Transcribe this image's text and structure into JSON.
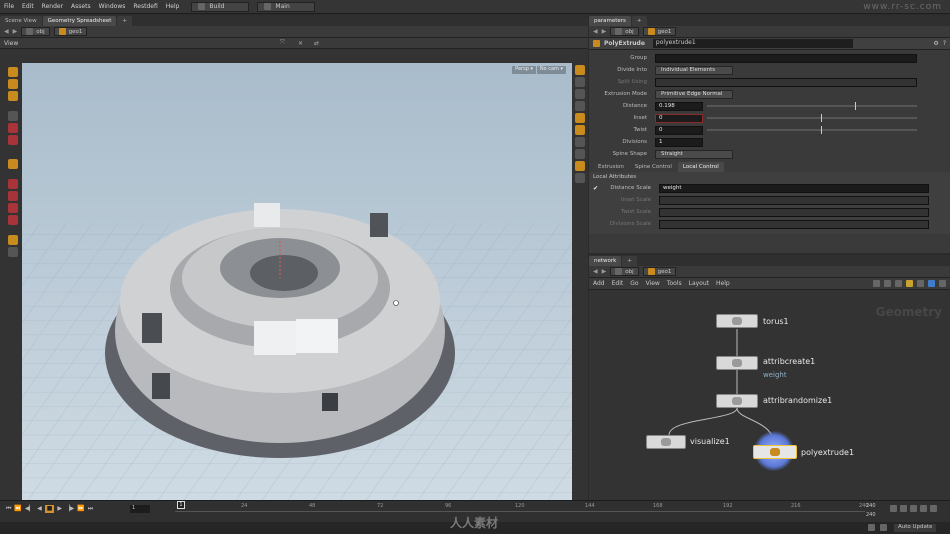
{
  "menu": [
    "File",
    "Edit",
    "Render",
    "Assets",
    "Windows",
    "Restdefi",
    "Help"
  ],
  "desktop_dropdown": "Build",
  "shelf_dropdown": "Main",
  "left_tabs": [
    "Scene View",
    "Geometry Spreadsheet"
  ],
  "left_path": [
    "obj",
    "geo1"
  ],
  "viewport": {
    "title": "View",
    "camera_btn": "Persp ▾",
    "display_btn": "No cam ▾"
  },
  "right_top_tabs": [
    "parameters"
  ],
  "right_path": [
    "obj",
    "geo1"
  ],
  "node_header": {
    "type": "PolyExtrude",
    "name": "polyextrude1"
  },
  "params": {
    "group_label": "Group",
    "divide_label": "Divide Into",
    "divide_value": "Individual Elements",
    "split_label": "Split Using",
    "extrusion_mode_label": "Extrusion Mode",
    "extrusion_mode_value": "Primitive Edge Normal",
    "distance_label": "Distance",
    "distance_value": "0.198",
    "inset_label": "Inset",
    "inset_value": "0",
    "twist_label": "Twist",
    "twist_value": "0",
    "divisions_label": "Divisions",
    "divisions_value": "1",
    "spine_label": "Spine Shape",
    "spine_value": "Straight"
  },
  "param_tabs": [
    "Extrusion",
    "Spine Control",
    "Local Control"
  ],
  "local": {
    "section": "Local Attributes",
    "dist_scale_label": "Distance Scale",
    "dist_scale_value": "weight",
    "rows": [
      "Inset Scale",
      "Twist Scale",
      "Divisions Scale"
    ]
  },
  "network": {
    "tab": "network",
    "path": [
      "obj",
      "geo1"
    ],
    "menu": [
      "Add",
      "Edit",
      "Go",
      "View",
      "Tools",
      "Layout",
      "Help"
    ],
    "watermark": "Geometry",
    "nodes": [
      {
        "name": "torus1"
      },
      {
        "name": "attribcreate1",
        "sub": "weight"
      },
      {
        "name": "attribrandomize1"
      },
      {
        "name": "visualize1"
      },
      {
        "name": "polyextrude1"
      }
    ]
  },
  "timeline": {
    "ticks": [
      "1",
      "24",
      "48",
      "72",
      "96",
      "120",
      "144",
      "168",
      "192",
      "216",
      "240"
    ],
    "frame_current": "1",
    "frame_start": "1",
    "frame_end": "240",
    "end_a": "240",
    "end_b": "240"
  },
  "status": {
    "auto_update": "Auto Update"
  },
  "watermark_center": "人人素材",
  "watermark_url": "www.rr-sc.com"
}
